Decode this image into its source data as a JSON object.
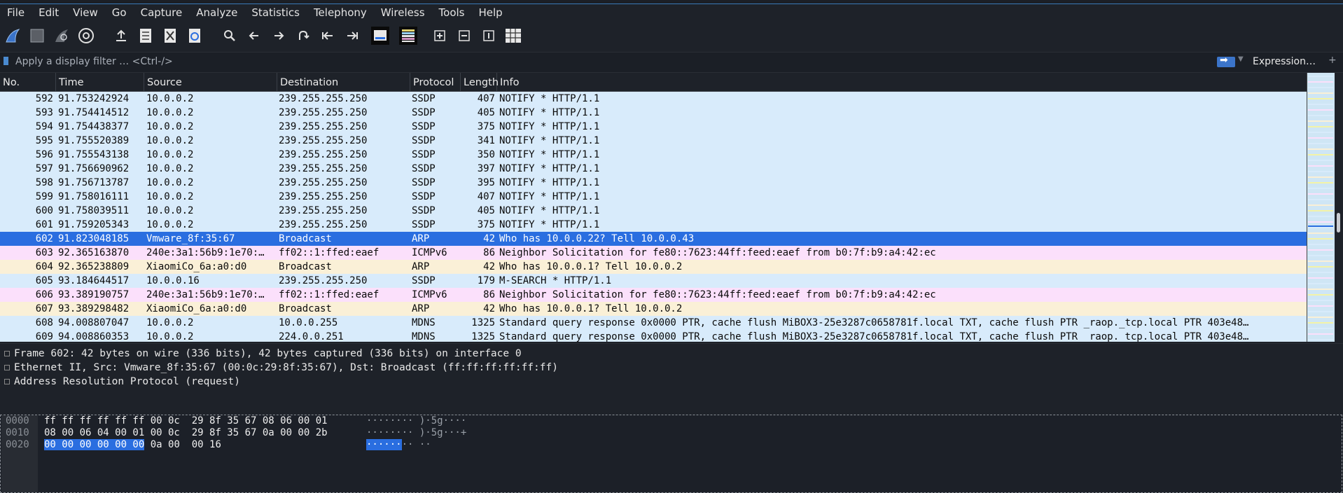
{
  "menubar": [
    "File",
    "Edit",
    "View",
    "Go",
    "Capture",
    "Analyze",
    "Statistics",
    "Telephony",
    "Wireless",
    "Tools",
    "Help"
  ],
  "toolbar": {
    "icons": [
      "shark-fin-start-icon",
      "stop-square-icon",
      "restart-fin-icon",
      "capture-options-gear-icon",
      "open-file-icon",
      "save-file-icon",
      "close-file-icon",
      "reload-icon",
      "find-packet-icon",
      "go-back-icon",
      "go-forward-icon",
      "go-to-packet-icon",
      "first-packet-icon",
      "last-packet-icon",
      "auto-scroll-icon",
      "colorize-icon",
      "zoom-in-icon",
      "zoom-out-icon",
      "normal-size-icon",
      "resize-columns-icon"
    ]
  },
  "filter": {
    "placeholder": "Apply a display filter … <Ctrl-/>",
    "expression_label": "Expression…",
    "plus_label": "+"
  },
  "packet_list": {
    "columns": [
      "No.",
      "Time",
      "Source",
      "Destination",
      "Protocol",
      "Length",
      "Info"
    ],
    "rows": [
      {
        "no": "592",
        "time": "91.753242924",
        "src": "10.0.0.2",
        "dst": "239.255.255.250",
        "proto": "SSDP",
        "len": "407",
        "info": "NOTIFY * HTTP/1.1",
        "color": "#d8ebfb"
      },
      {
        "no": "593",
        "time": "91.754414512",
        "src": "10.0.0.2",
        "dst": "239.255.255.250",
        "proto": "SSDP",
        "len": "405",
        "info": "NOTIFY * HTTP/1.1",
        "color": "#d8ebfb"
      },
      {
        "no": "594",
        "time": "91.754438377",
        "src": "10.0.0.2",
        "dst": "239.255.255.250",
        "proto": "SSDP",
        "len": "375",
        "info": "NOTIFY * HTTP/1.1",
        "color": "#d8ebfb"
      },
      {
        "no": "595",
        "time": "91.755520389",
        "src": "10.0.0.2",
        "dst": "239.255.255.250",
        "proto": "SSDP",
        "len": "341",
        "info": "NOTIFY * HTTP/1.1",
        "color": "#d8ebfb"
      },
      {
        "no": "596",
        "time": "91.755543138",
        "src": "10.0.0.2",
        "dst": "239.255.255.250",
        "proto": "SSDP",
        "len": "350",
        "info": "NOTIFY * HTTP/1.1",
        "color": "#d8ebfb"
      },
      {
        "no": "597",
        "time": "91.756690962",
        "src": "10.0.0.2",
        "dst": "239.255.255.250",
        "proto": "SSDP",
        "len": "397",
        "info": "NOTIFY * HTTP/1.1",
        "color": "#d8ebfb"
      },
      {
        "no": "598",
        "time": "91.756713787",
        "src": "10.0.0.2",
        "dst": "239.255.255.250",
        "proto": "SSDP",
        "len": "395",
        "info": "NOTIFY * HTTP/1.1",
        "color": "#d8ebfb"
      },
      {
        "no": "599",
        "time": "91.758016111",
        "src": "10.0.0.2",
        "dst": "239.255.255.250",
        "proto": "SSDP",
        "len": "407",
        "info": "NOTIFY * HTTP/1.1",
        "color": "#d8ebfb"
      },
      {
        "no": "600",
        "time": "91.758039511",
        "src": "10.0.0.2",
        "dst": "239.255.255.250",
        "proto": "SSDP",
        "len": "405",
        "info": "NOTIFY * HTTP/1.1",
        "color": "#d8ebfb"
      },
      {
        "no": "601",
        "time": "91.759205343",
        "src": "10.0.0.2",
        "dst": "239.255.255.250",
        "proto": "SSDP",
        "len": "375",
        "info": "NOTIFY * HTTP/1.1",
        "color": "#d8ebfb"
      },
      {
        "no": "602",
        "time": "91.823048185",
        "src": "Vmware_8f:35:67",
        "dst": "Broadcast",
        "proto": "ARP",
        "len": "42",
        "info": "Who has 10.0.0.22? Tell 10.0.0.43",
        "color": "#2a6ee0",
        "selected": true
      },
      {
        "no": "603",
        "time": "92.365163870",
        "src": "240e:3a1:56b9:1e70:…",
        "dst": "ff02::1:ffed:eaef",
        "proto": "ICMPv6",
        "len": "86",
        "info": "Neighbor Solicitation for fe80::7623:44ff:feed:eaef from b0:7f:b9:a4:42:ec",
        "color": "#fbe0fb"
      },
      {
        "no": "604",
        "time": "92.365238809",
        "src": "XiaomiCo_6a:a0:d0",
        "dst": "Broadcast",
        "proto": "ARP",
        "len": "42",
        "info": "Who has 10.0.0.1? Tell 10.0.0.2",
        "color": "#faf0d7"
      },
      {
        "no": "605",
        "time": "93.184644517",
        "src": "10.0.0.16",
        "dst": "239.255.255.250",
        "proto": "SSDP",
        "len": "179",
        "info": "M-SEARCH * HTTP/1.1",
        "color": "#d8ebfb"
      },
      {
        "no": "606",
        "time": "93.389190757",
        "src": "240e:3a1:56b9:1e70:…",
        "dst": "ff02::1:ffed:eaef",
        "proto": "ICMPv6",
        "len": "86",
        "info": "Neighbor Solicitation for fe80::7623:44ff:feed:eaef from b0:7f:b9:a4:42:ec",
        "color": "#fbe0fb"
      },
      {
        "no": "607",
        "time": "93.389298482",
        "src": "XiaomiCo_6a:a0:d0",
        "dst": "Broadcast",
        "proto": "ARP",
        "len": "42",
        "info": "Who has 10.0.0.1? Tell 10.0.0.2",
        "color": "#faf0d7"
      },
      {
        "no": "608",
        "time": "94.008807047",
        "src": "10.0.0.2",
        "dst": "10.0.0.255",
        "proto": "MDNS",
        "len": "1325",
        "info": "Standard query response 0x0000 PTR, cache flush MiBOX3-25e3287c0658781f.local TXT, cache flush PTR _raop._tcp.local PTR 403e48…",
        "color": "#d8ebfb"
      },
      {
        "no": "609",
        "time": "94.008860353",
        "src": "10.0.0.2",
        "dst": "224.0.0.251",
        "proto": "MDNS",
        "len": "1325",
        "info": "Standard query response 0x0000 PTR, cache flush MiBOX3-25e3287c0658781f.local TXT, cache flush PTR _raop._tcp.local PTR 403e48…",
        "color": "#d8ebfb"
      }
    ]
  },
  "details": [
    "Frame 602: 42 bytes on wire (336 bits), 42 bytes captured (336 bits) on interface 0",
    "Ethernet II, Src: Vmware_8f:35:67 (00:0c:29:8f:35:67), Dst: Broadcast (ff:ff:ff:ff:ff:ff)",
    "Address Resolution Protocol (request)"
  ],
  "hex": {
    "offsets": [
      "0000",
      "0010",
      "0020"
    ],
    "line0_bytes": "ff ff ff ff ff ff 00 0c  29 8f 35 67 08 06 00 01",
    "line0_ascii": "········ )·5g····",
    "line1_bytes": "08 00 06 04 00 01 00 0c  29 8f 35 67 0a 00 00 2b",
    "line1_ascii": "········ )·5g···+",
    "line2_bytes_hl": "00 00 00 00 00 00",
    "line2_bytes_rest": " 0a 00  00 16",
    "line2_ascii_hl": "······",
    "line2_ascii_rest": "·· ··"
  },
  "colors": {
    "ssdp": "#d8ebfb",
    "icmpv6": "#fbe0fb",
    "arp": "#faf0d7",
    "selected": "#2a6ee0"
  }
}
